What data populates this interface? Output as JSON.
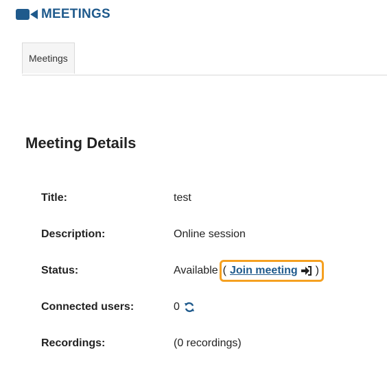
{
  "header": {
    "title": "MEETINGS",
    "icon": "video-camera-icon",
    "color": "#1f5a8c"
  },
  "tabs": [
    {
      "label": "Meetings"
    }
  ],
  "details": {
    "heading": "Meeting Details",
    "title_label": "Title:",
    "title_value": "test",
    "description_label": "Description:",
    "description_value": "Online session",
    "status_label": "Status:",
    "status_value": "Available",
    "paren_open": "(",
    "join_label": "Join meeting",
    "join_icon": "sign-in-icon",
    "paren_close": ")",
    "connected_label": "Connected users:",
    "connected_value": "0",
    "connected_icon": "refresh-icon",
    "recordings_label": "Recordings:",
    "recordings_value": "(0 recordings)"
  },
  "colors": {
    "link": "#1f5a8c",
    "highlight": "#f5a020"
  }
}
